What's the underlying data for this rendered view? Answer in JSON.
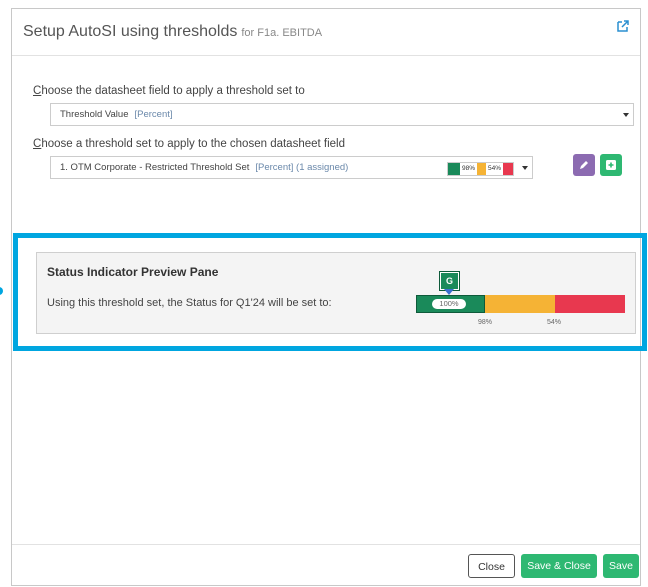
{
  "dialog": {
    "title": "Setup AutoSI using thresholds",
    "subtitle": "for F1a. EBITDA"
  },
  "field_select": {
    "label": "Choose the datasheet field to apply a threshold set to",
    "value": "Threshold Value",
    "unit": "[Percent]"
  },
  "threshold_select": {
    "label": "Choose a threshold set to apply to the chosen datasheet field",
    "value": "1. OTM Corporate - Restricted Threshold Set",
    "unit": "[Percent] (1 assigned)",
    "chip_1": "98%",
    "chip_2": "54%"
  },
  "preview": {
    "title": "Status Indicator Preview Pane",
    "text": "Using this threshold set, the Status for Q1'24 will be set to:",
    "status_letter": "G",
    "current_value": "100%",
    "tick_1": "98%",
    "tick_2": "54%"
  },
  "colors": {
    "green": "#1a8a5a",
    "amber": "#f5b335",
    "red": "#e8384f",
    "purple": "#8c6bb1",
    "button_green": "#2eb872",
    "highlight": "#00a6e0"
  },
  "icons": {
    "popout": "external-link-icon",
    "edit": "pencil-icon",
    "add": "plus-square-icon"
  },
  "footer": {
    "close": "Close",
    "save_close": "Save & Close",
    "save": "Save"
  }
}
